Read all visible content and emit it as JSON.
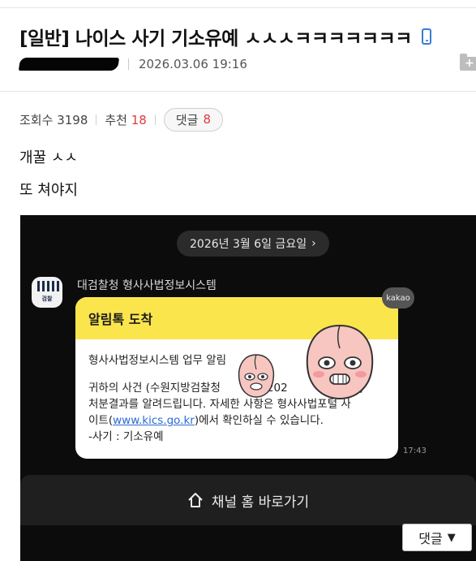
{
  "post": {
    "title": "[일반] 나이스 사기 기소유예 ㅅㅅㅅㅋㅋㅋㅋㅋㅋㅋ",
    "date": "2026.03.06 19:16",
    "views_label": "조회수",
    "views": "3198",
    "recommend_label": "추천",
    "recommend": "18",
    "comments_label": "댓글",
    "comments": "8",
    "body_lines": [
      "개꿀 ㅅㅅ",
      "또 쳐야지"
    ]
  },
  "chat": {
    "date_chip": "2026년 3월 6일 금요일",
    "date_chip_arrow": "›",
    "logo_text": "검찰",
    "sender": "대검찰청 형사사법정보시스템",
    "kakao_badge": "kakao",
    "bubble_title": "알림톡 도착",
    "bubble_line1": "형사사법정보시스템 업무 알림",
    "bubble_line2": "귀하의 사건 (수원지방검찰청 ",
    "bubble_line2_tail": "청 202",
    "bubble_line2_end": "7)",
    "bubble_line3": "처분결과를 알려드립니다. 자세한 사항은 형사사법포털 사",
    "bubble_line4_pre": "이트(",
    "bubble_link": "www.kics.go.kr",
    "bubble_line4_post": ")에서 확인하실 수 있습니다.",
    "bubble_line5": "-사기 : 기소유예",
    "time": "17:43",
    "channel_button": "채널 홈 바로가기"
  },
  "floating": {
    "comments_button": "댓글",
    "comments_arrow": "▼"
  },
  "colors": {
    "recommend_red": "#e0393e",
    "kakao_yellow": "#fbe54d",
    "link_blue": "#2a6bd4"
  }
}
